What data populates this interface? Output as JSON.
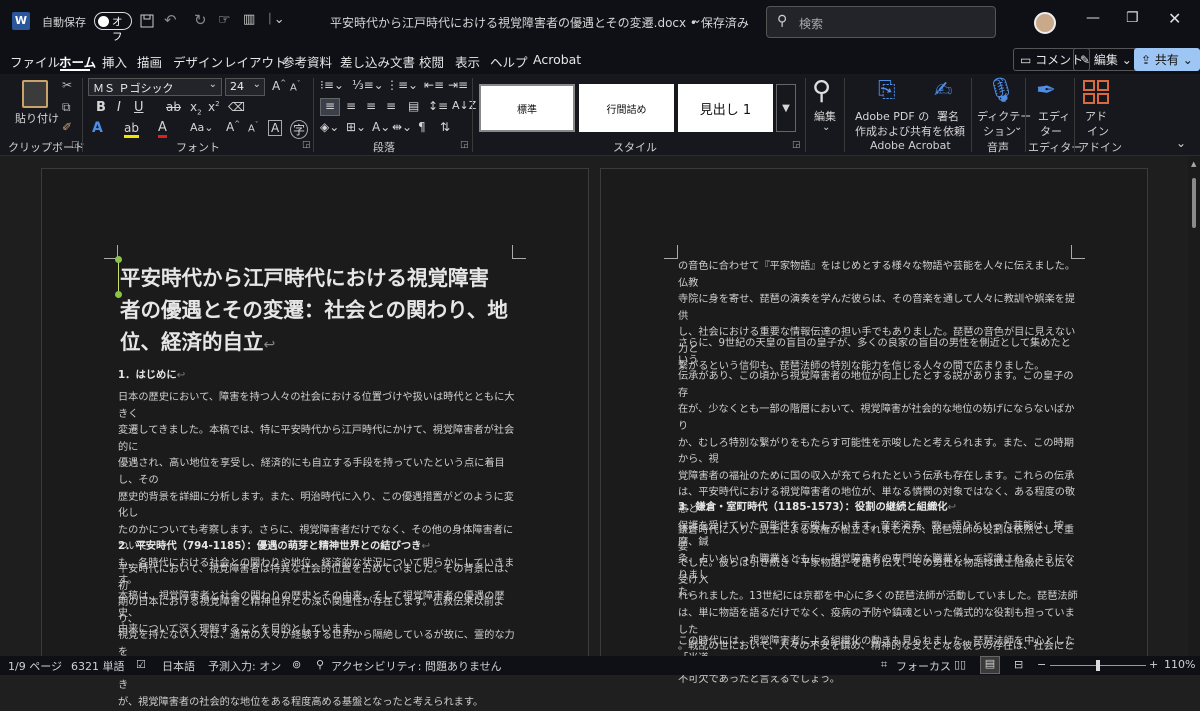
{
  "titlebar": {
    "autosave_label": "自動保存",
    "autosave_state": "オフ",
    "doc_title": "平安時代から江戸時代における視覚障害者の優遇とその変遷.docx • 保存済み",
    "search_placeholder": "検索"
  },
  "menu": {
    "items": [
      "ファイル",
      "ホーム",
      "挿入",
      "描画",
      "デザイン",
      "レイアウト",
      "参考資料",
      "差し込み文書",
      "校閲",
      "表示",
      "ヘルプ",
      "Acrobat"
    ],
    "comment": "コメント",
    "edit": "編集",
    "share": "共有"
  },
  "ribbon": {
    "paste": "貼り付け",
    "font_name": "ＭＳ Ｐゴシック",
    "font_size": "24",
    "styles": [
      "標準",
      "行間詰め",
      "見出し 1"
    ],
    "edit_label": "編集",
    "adobe_pdf": "Adobe PDF の",
    "adobe_pdf2": "作成および共有",
    "sign": "署名",
    "sign2": "を依頼",
    "dictate": "ディクテー",
    "dictate2": "ション",
    "editor": "エディ",
    "editor2": "ター",
    "addin": "アド",
    "addin2": "イン",
    "groups": [
      "クリップボード",
      "フォント",
      "段落",
      "スタイル",
      "Adobe Acrobat",
      "音声",
      "エディター",
      "アドイン"
    ]
  },
  "page1": {
    "title_l1": "平安時代から江戸時代における視覚障害",
    "title_l2": "者の優遇とその変遷：社会との関わり、地",
    "title_l3": "位、経済的自立",
    "h1": "1．はじめに",
    "p1": "日本の歴史において、障害を持つ人々の社会における位置づけや扱いは時代とともに大きく\n変遷してきました。本稿では、特に平安時代から江戸時代にかけて、視覚障害者が社会的に\n優遇され、高い地位を享受し、経済的にも自立する手段を持っていたという点に着目し、その\n歴史的背景を詳細に分析します。また、明治時代に入り、この優遇措置がどのように変化し\nたのかについても考察します。さらに、視覚障害者だけでなく、その他の身体障害者について\nも、各時代における社会との関わりや地位、経済的な状況について明らかにしていきます。\n本稿は、視覚障害者と社会の関わりの歴史とその由来、そして視覚障害者の優遇の歴史、\n由来について深く理解することを目的としています。",
    "h2": "2．平安時代（794-1185）：優遇の萌芽と精神世界との結びつき",
    "p2": "平安時代において、視覚障害者は特異な社会的位置を占めていました。その背景には、初\n期の日本における視覚障害と精神世界との深い関連性が存在します。仏教伝来以前より、\n視覚を持たない人々は、通常の人々が経験する世界から隔絶しているが故に、霊的な力を\n持つシャーマン的な存在として尊重される傾向がありました。この精神世界との結びつき\nが、視覚障害者の社会的な地位をある程度高める基盤となったと考えられます。"
  },
  "page2": {
    "p1": "の音色に合わせて『平家物語』をはじめとする様々な物語や芸能を人々に伝えました。仏教\n寺院に身を寄せ、琵琶の演奏を学んだ彼らは、その音楽を通して人々に教訓や娯楽を提供\nし、社会における重要な情報伝達の担い手でもありました。琵琶の音色が目に見えない力と\n繋がるという信仰も、琵琶法師の特別な能力を信じる人々の間で広まりました。",
    "p2": "さらに、9世紀の天皇の盲目の皇子が、多くの良家の盲目の男性を側近として集めたという\n伝承があり、この頃から視覚障害者の地位が向上したとする説があります。この皇子の存\n在が、少なくとも一部の階層において、視覚障害が社会的な地位の妨げにならないばかり\nか、むしろ特別な繋がりをもたらす可能性を示唆したと考えられます。また、この時期から、視\n覚障害者の福祉のために国の収入が充てられたという伝承も存在します。これらの伝承\nは、平安時代における視覚障害者の地位が、単なる憐憫の対象ではなく、ある程度の敬意と\n保護を受けていた可能性を示唆しています。音楽演奏、歌、語りといった芸能は、按摩、鍼\n灸、占いといった職業とともに、視覚障害者の専門的な職業として認識されるようになりまし\nた。",
    "h3": "3．鎌倉・室町時代（1185-1573）：役割の継続と組織化",
    "p3": "鎌倉時代に入り、武士による政権が樹立されましたが、琵琶法師の役割は依然として重要\nでした。彼らは引き続き『平家物語』を語り伝え、その勇壮な物語は武士階級にも広く受け入\nれられました。13世紀には京都を中心に多くの琵琶法師が活動していました。琵琶法師\nは、単に物語を語るだけでなく、疫病の予防や鎮魂といった儀式的な役割も担っていました\n。戦乱の世において、人々の不安を鎮め、精神的な支えとなる彼らの存在は、社会にとって\n不可欠であったと言えるでしょう。",
    "p4": "この時代には、視覚障害者による組織化の動きも見られました。琵琶法師を中心とした「当道"
  },
  "status": {
    "page": "1/9 ページ",
    "words": "6321 単語",
    "lang": "日本語",
    "predict": "予測入力: オン",
    "access": "アクセシビリティ: 問題ありません",
    "focus": "フォーカス",
    "zoom": "110%"
  }
}
